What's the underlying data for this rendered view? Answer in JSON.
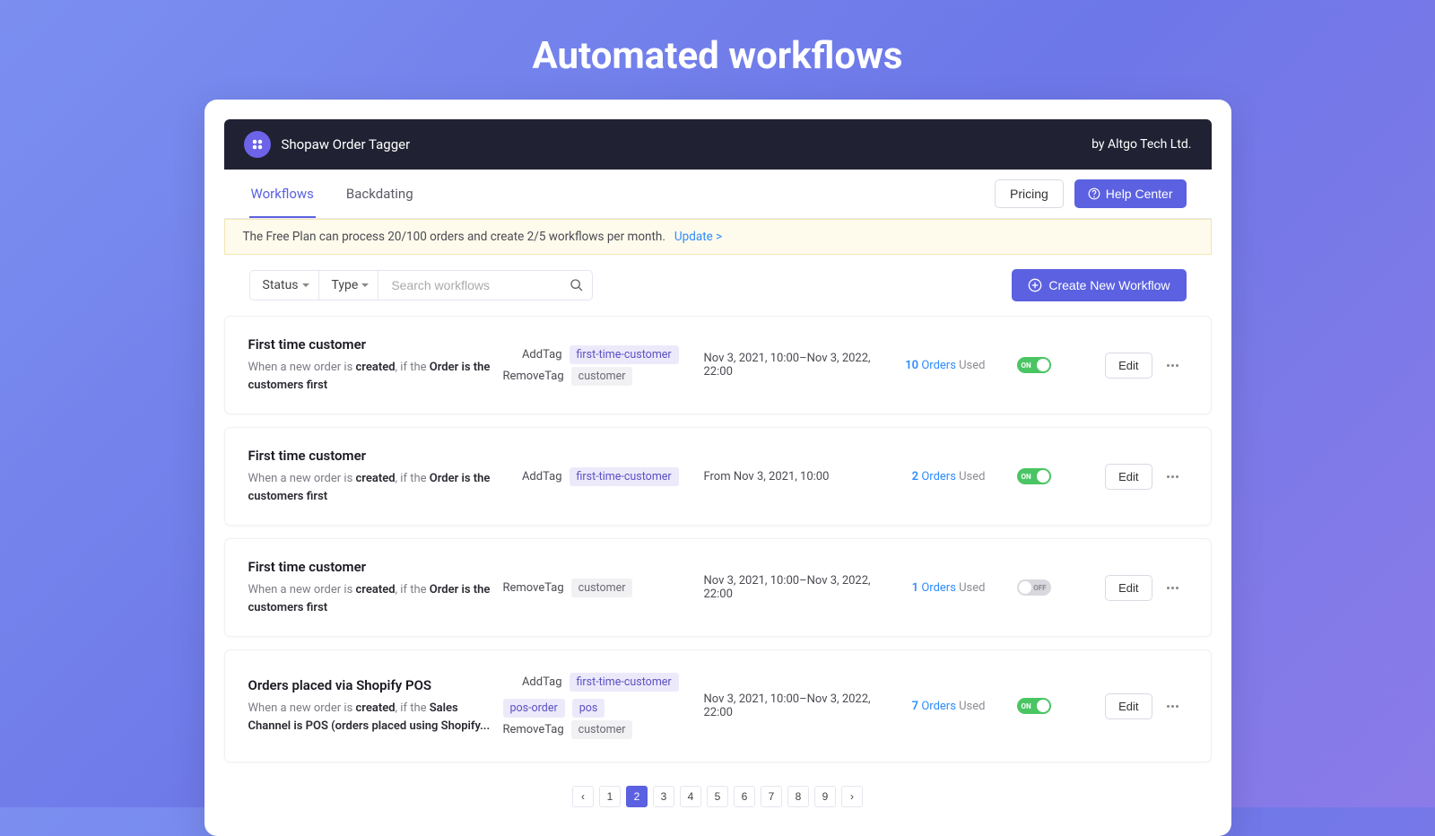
{
  "page_title": "Automated workflows",
  "header": {
    "app_name": "Shopaw Order Tagger",
    "vendor": "by Altgo Tech Ltd."
  },
  "tabs": {
    "workflows": "Workflows",
    "backdating": "Backdating",
    "pricing": "Pricing",
    "help": "Help Center"
  },
  "notice": {
    "text": "The Free Plan can process 20/100 orders and create 2/5 workflows per month.",
    "link": "Update >"
  },
  "filters": {
    "status": "Status",
    "type": "Type",
    "search_placeholder": "Search workflows",
    "create": "Create New Workflow"
  },
  "rows": [
    {
      "title": "First time customer",
      "desc_pre": "When a new order is ",
      "desc_bold1": "created",
      "desc_mid": ", if the ",
      "desc_bold2": "Order is the customers first",
      "add_label": "AddTag",
      "add_tags": [
        "first-time-customer"
      ],
      "remove_label": "RemoveTag",
      "remove_tags": [
        "customer"
      ],
      "date": "Nov 3, 2021, 10:00–Nov 3, 2022, 22:00",
      "usage_num": "10",
      "usage_orders": " Orders",
      "usage_used": " Used",
      "toggle": "on",
      "toggle_label": "ON"
    },
    {
      "title": "First time customer",
      "desc_pre": "When a new order is ",
      "desc_bold1": "created",
      "desc_mid": ", if the ",
      "desc_bold2": "Order is the customers first",
      "add_label": "AddTag",
      "add_tags": [
        "first-time-customer"
      ],
      "remove_label": "",
      "remove_tags": [],
      "date": "From Nov 3, 2021, 10:00",
      "usage_num": "2",
      "usage_orders": " Orders",
      "usage_used": " Used",
      "toggle": "on",
      "toggle_label": "ON"
    },
    {
      "title": "First time customer",
      "desc_pre": "When a new order is ",
      "desc_bold1": "created",
      "desc_mid": ", if the ",
      "desc_bold2": "Order is the customers first",
      "add_label": "",
      "add_tags": [],
      "remove_label": "RemoveTag",
      "remove_tags": [
        "customer"
      ],
      "date": "Nov 3, 2021, 10:00–Nov 3, 2022, 22:00",
      "usage_num": "1",
      "usage_orders": " Orders",
      "usage_used": " Used",
      "toggle": "off",
      "toggle_label": "OFF"
    },
    {
      "title": "Orders placed via Shopify POS",
      "desc_pre": "When a new order is ",
      "desc_bold1": "created",
      "desc_mid": ", if the ",
      "desc_bold2": "Sales Channel is POS (orders placed using Shopify...",
      "add_label": "AddTag",
      "add_tags": [
        "first-time-customer",
        "pos-order",
        "pos"
      ],
      "remove_label": "RemoveTag",
      "remove_tags": [
        "customer"
      ],
      "date": "Nov 3, 2021, 10:00–Nov 3, 2022, 22:00",
      "usage_num": "7",
      "usage_orders": " Orders",
      "usage_used": " Used",
      "toggle": "on",
      "toggle_label": "ON"
    }
  ],
  "edit_label": "Edit",
  "pagination": {
    "pages": [
      "1",
      "2",
      "3",
      "4",
      "5",
      "6",
      "7",
      "8",
      "9"
    ],
    "active": "2"
  }
}
